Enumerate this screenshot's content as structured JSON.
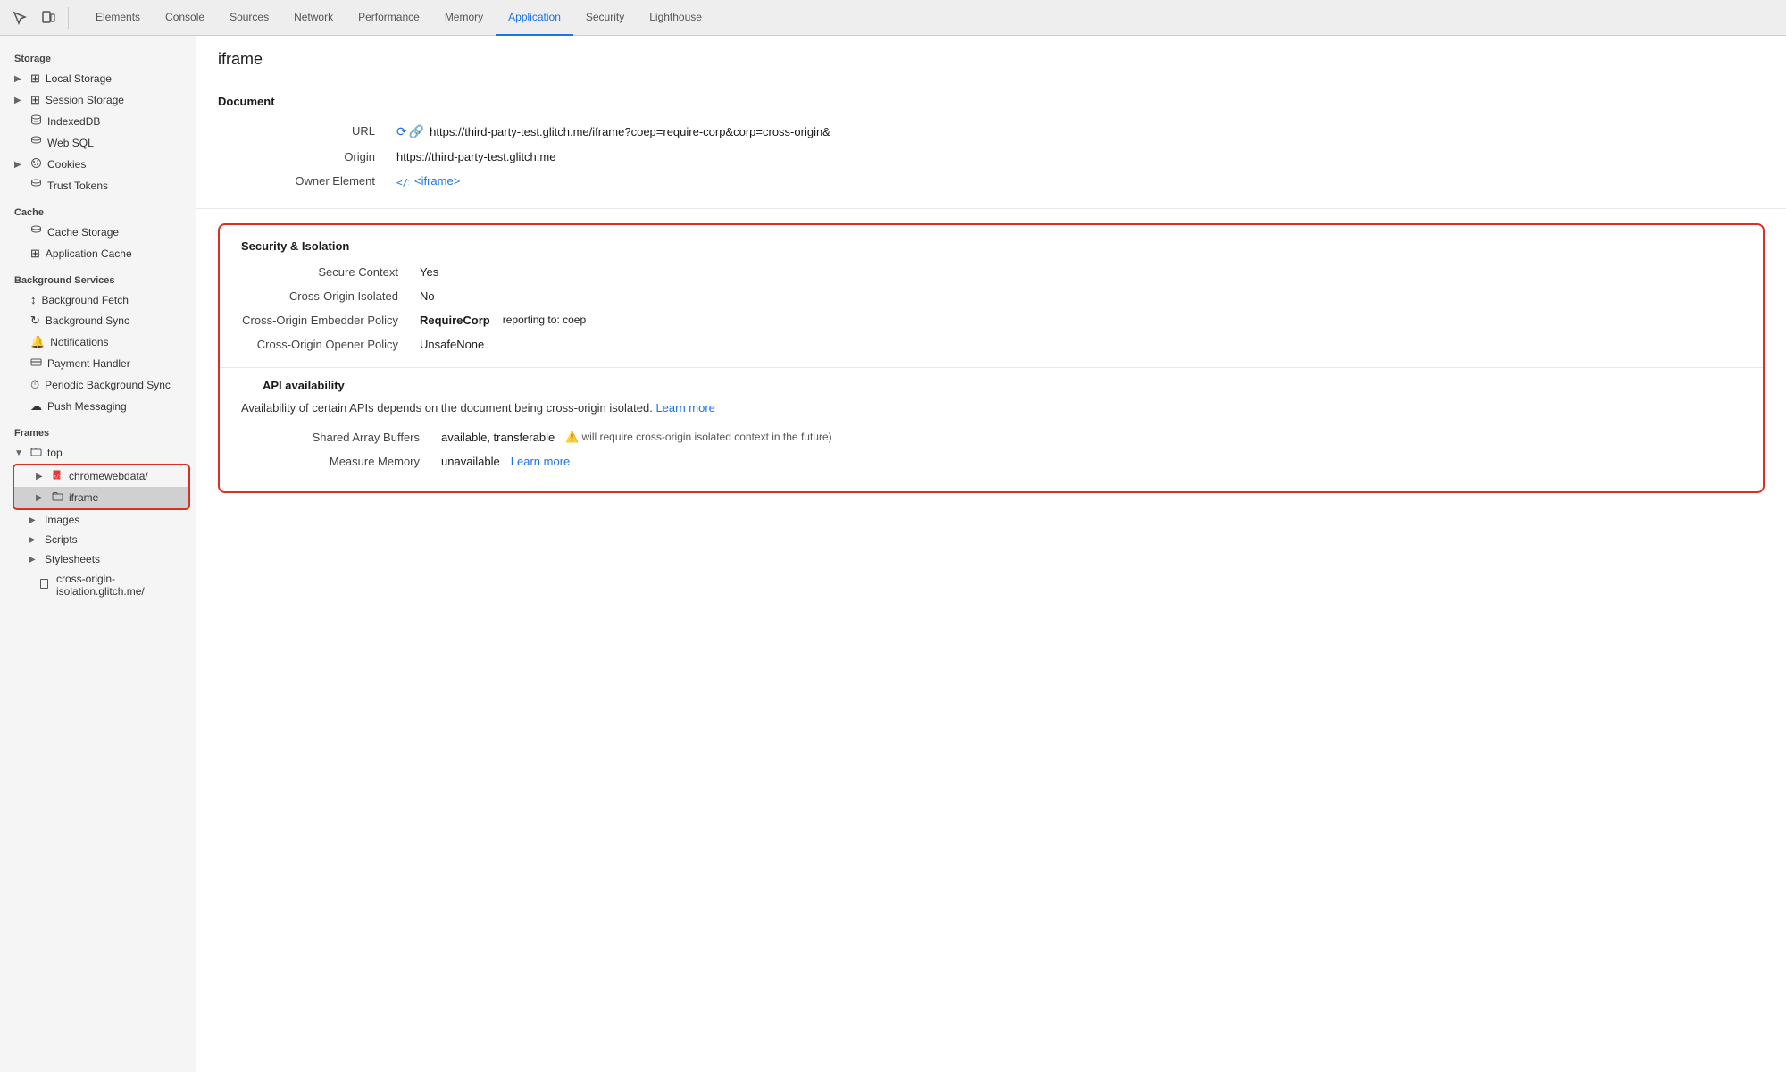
{
  "toolbar": {
    "icons": [
      "inspect",
      "device-toolbar"
    ],
    "tabs": [
      {
        "id": "elements",
        "label": "Elements"
      },
      {
        "id": "console",
        "label": "Console"
      },
      {
        "id": "sources",
        "label": "Sources"
      },
      {
        "id": "network",
        "label": "Network"
      },
      {
        "id": "performance",
        "label": "Performance"
      },
      {
        "id": "memory",
        "label": "Memory"
      },
      {
        "id": "application",
        "label": "Application",
        "active": true
      },
      {
        "id": "security",
        "label": "Security"
      },
      {
        "id": "lighthouse",
        "label": "Lighthouse"
      }
    ]
  },
  "sidebar": {
    "storage_label": "Storage",
    "storage_items": [
      {
        "id": "local-storage",
        "label": "Local Storage",
        "icon": "⊞",
        "expandable": true
      },
      {
        "id": "session-storage",
        "label": "Session Storage",
        "icon": "⊞",
        "expandable": true
      },
      {
        "id": "indexed-db",
        "label": "IndexedDB",
        "icon": "🗄"
      },
      {
        "id": "web-sql",
        "label": "Web SQL",
        "icon": "🗄"
      },
      {
        "id": "cookies",
        "label": "Cookies",
        "icon": "🍪",
        "expandable": true
      },
      {
        "id": "trust-tokens",
        "label": "Trust Tokens",
        "icon": "🗄"
      }
    ],
    "cache_label": "Cache",
    "cache_items": [
      {
        "id": "cache-storage",
        "label": "Cache Storage",
        "icon": "🗄"
      },
      {
        "id": "application-cache",
        "label": "Application Cache",
        "icon": "⊞"
      }
    ],
    "bg_services_label": "Background Services",
    "bg_services_items": [
      {
        "id": "bg-fetch",
        "label": "Background Fetch",
        "icon": "↕"
      },
      {
        "id": "bg-sync",
        "label": "Background Sync",
        "icon": "↻"
      },
      {
        "id": "notifications",
        "label": "Notifications",
        "icon": "🔔"
      },
      {
        "id": "payment-handler",
        "label": "Payment Handler",
        "icon": "🪪"
      },
      {
        "id": "periodic-bg-sync",
        "label": "Periodic Background Sync",
        "icon": "⏱"
      },
      {
        "id": "push-messaging",
        "label": "Push Messaging",
        "icon": "☁"
      }
    ],
    "frames_label": "Frames",
    "frames_items": [
      {
        "id": "top",
        "label": "top",
        "icon": "📁",
        "expandable": true,
        "expanded": true
      },
      {
        "id": "chromewebdata",
        "label": "chromewebdata/",
        "icon": "📄",
        "indent": 1,
        "expandable": true,
        "highlight": true
      },
      {
        "id": "iframe",
        "label": "iframe",
        "icon": "📁",
        "indent": 1,
        "expandable": true,
        "active": true,
        "highlight": true
      },
      {
        "id": "images",
        "label": "Images",
        "indent": 1,
        "expandable": true
      },
      {
        "id": "scripts",
        "label": "Scripts",
        "indent": 1,
        "expandable": true
      },
      {
        "id": "stylesheets",
        "label": "Stylesheets",
        "indent": 1,
        "expandable": true
      },
      {
        "id": "cross-origin",
        "label": "cross-origin-isolation.glitch.me/",
        "icon": "📄",
        "indent": 2
      }
    ]
  },
  "content": {
    "page_title": "iframe",
    "document_section_title": "Document",
    "url_label": "URL",
    "url_value": "https://third-party-test.glitch.me/iframe?coep=require-corp&corp=cross-origin&",
    "origin_label": "Origin",
    "origin_value": "https://third-party-test.glitch.me",
    "owner_label": "Owner Element",
    "owner_value": "<iframe>",
    "security_section_title": "Security & Isolation",
    "secure_context_label": "Secure Context",
    "secure_context_value": "Yes",
    "cross_origin_isolated_label": "Cross-Origin Isolated",
    "cross_origin_isolated_value": "No",
    "coep_label": "Cross-Origin Embedder Policy",
    "coep_value": "RequireCorp",
    "coep_reporting_prefix": "reporting to:",
    "coep_reporting_value": "coep",
    "coop_label": "Cross-Origin Opener Policy",
    "coop_value": "UnsafeNone",
    "api_section_title": "API availability",
    "api_desc": "Availability of certain APIs depends on the document being cross-origin isolated.",
    "api_learn_more": "Learn more",
    "shared_array_label": "Shared Array Buffers",
    "shared_array_value": "available, transferable",
    "shared_array_note": "(⚠️ will require cross-origin isolated context in the future)",
    "measure_memory_label": "Measure Memory",
    "measure_memory_value": "unavailable",
    "measure_memory_learn_more": "Learn more"
  }
}
